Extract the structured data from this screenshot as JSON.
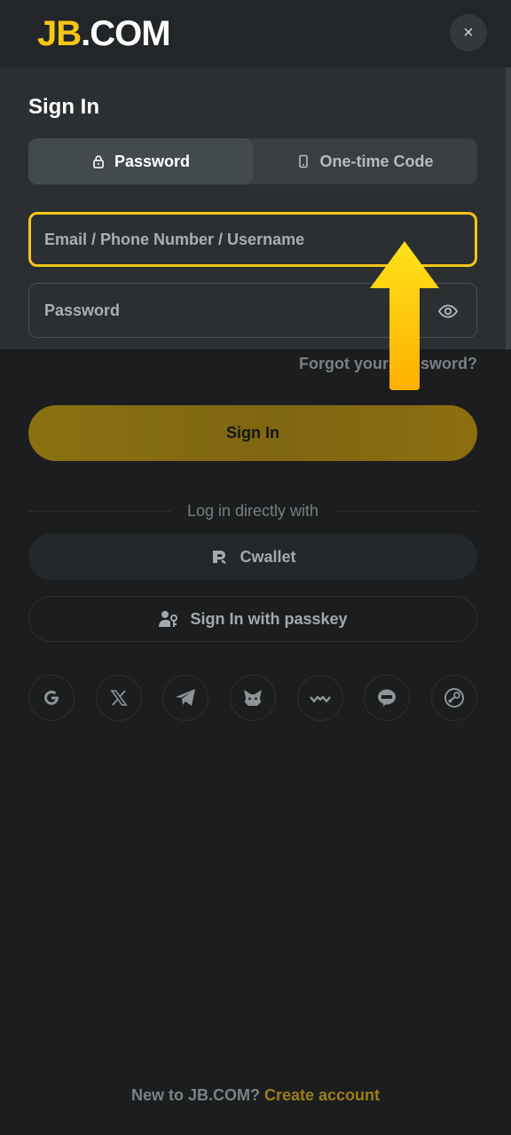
{
  "header": {
    "logo_main": "JB",
    "logo_suffix": ".COM",
    "close_label": "×"
  },
  "form": {
    "title": "Sign In",
    "tabs": [
      {
        "label": "Password",
        "icon": "lock-icon",
        "active": true
      },
      {
        "label": "One-time Code",
        "icon": "phone-icon",
        "active": false
      }
    ],
    "identifier_placeholder": "Email / Phone Number / Username",
    "password_placeholder": "Password",
    "forgot_label": "Forgot your password?",
    "submit_label": "Sign In"
  },
  "alt_login": {
    "divider_label": "Log in directly with",
    "cwallet_label": "Cwallet",
    "passkey_label": "Sign In with passkey",
    "social_icons": [
      "google-icon",
      "x-icon",
      "telegram-icon",
      "metamask-icon",
      "walletconnect-icon",
      "line-icon",
      "steam-icon"
    ]
  },
  "footer": {
    "prompt": "New to JB.COM?",
    "link_label": "Create account"
  },
  "colors": {
    "brand_yellow": "#f5c518",
    "button_gold": "#8a7110",
    "background": "#1a1c1d"
  }
}
